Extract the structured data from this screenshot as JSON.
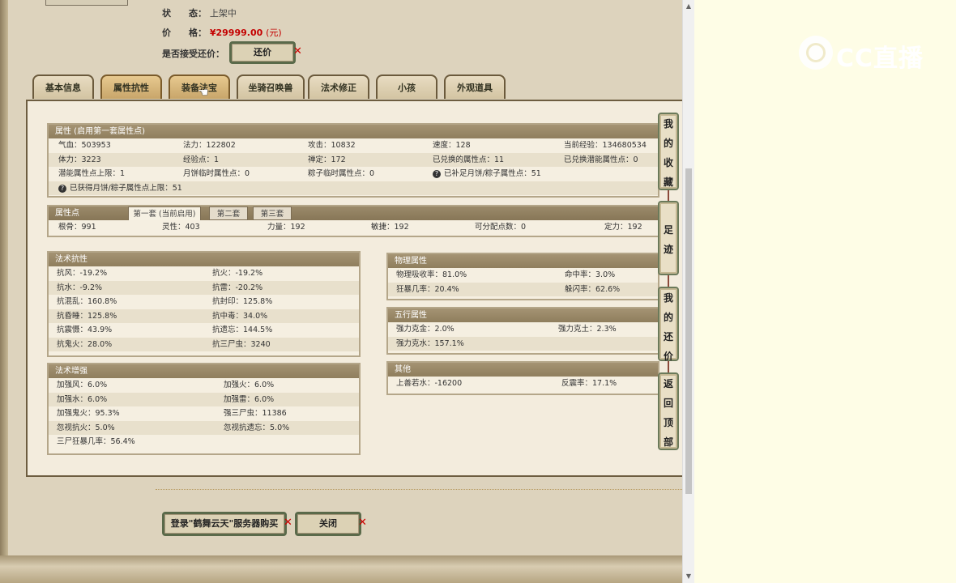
{
  "item_info": {
    "status_label": "状　　态：",
    "status_value": "上架中",
    "price_label": "价　　格：",
    "price_value": "¥29999.00",
    "price_unit": "(元)",
    "counter_offer_label": "是否接受还价：",
    "counter_offer_button": "还价"
  },
  "tabs": [
    "基本信息",
    "属性抗性",
    "装备法宝",
    "坐骑召唤兽",
    "法术修正",
    "小孩",
    "外观道具"
  ],
  "attributes": {
    "title": "属性 (启用第一套属性点)",
    "rows": [
      [
        "气血：503953",
        "法力：122802",
        "攻击：10832",
        "速度：128",
        "当前经验：134680534"
      ],
      [
        "体力：3223",
        "经验点：1",
        "禅定：172",
        "已兑换的属性点：11",
        "已兑换潜能属性点：0"
      ],
      [
        "潜能属性点上限：1",
        "月饼临时属性点：0",
        "粽子临时属性点：0",
        "已补足月饼/粽子属性点：51",
        ""
      ],
      [
        "已获得月饼/粽子属性点上限：51",
        "",
        "",
        "",
        ""
      ]
    ]
  },
  "attr_points": {
    "title": "属性点",
    "subtabs": [
      "第一套 (当前启用)",
      "第二套",
      "第三套"
    ],
    "values": [
      "根骨：991",
      "灵性：403",
      "力量：192",
      "敏捷：192",
      "可分配点数：0",
      "定力：192"
    ]
  },
  "spell_resist": {
    "title": "法术抗性",
    "rows": [
      [
        "抗风：-19.2%",
        "抗火：-19.2%"
      ],
      [
        "抗水：-9.2%",
        "抗雷：-20.2%"
      ],
      [
        "抗混乱：160.8%",
        "抗封印：125.8%"
      ],
      [
        "抗昏睡：125.8%",
        "抗中毒：34.0%"
      ],
      [
        "抗震慑：43.9%",
        "抗遗忘：144.5%"
      ],
      [
        "抗鬼火：28.0%",
        "抗三尸虫：3240"
      ]
    ]
  },
  "spell_enhance": {
    "title": "法术增强",
    "rows": [
      [
        "加强风：6.0%",
        "加强火：6.0%"
      ],
      [
        "加强水：6.0%",
        "加强雷：6.0%"
      ],
      [
        "加强鬼火：95.3%",
        "强三尸虫：11386"
      ],
      [
        "忽视抗火：5.0%",
        "忽视抗遗忘：5.0%"
      ],
      [
        "三尸狂暴几率：56.4%",
        ""
      ]
    ]
  },
  "physical": {
    "title": "物理属性",
    "rows": [
      [
        "物理吸收率：81.0%",
        "命中率：3.0%"
      ],
      [
        "狂暴几率：20.4%",
        "躲闪率：62.6%"
      ]
    ]
  },
  "five_elements": {
    "title": "五行属性",
    "rows": [
      [
        "强力克金：2.0%",
        "强力克土：2.3%"
      ],
      [
        "强力克水：157.1%",
        ""
      ]
    ]
  },
  "other": {
    "title": "其他",
    "rows": [
      [
        "上善若水：-16200",
        "反震率：17.1%"
      ]
    ]
  },
  "sidebar": {
    "favorites": [
      "我",
      "的",
      "收",
      "藏"
    ],
    "footprints": [
      "足",
      "迹"
    ],
    "my_offers": [
      "我",
      "的",
      "还",
      "价"
    ],
    "back_top": [
      "返",
      "回",
      "顶",
      "部"
    ]
  },
  "footer": {
    "login_button": "登录\"鹤舞云天\"服务器购买",
    "close_button": "关闭"
  },
  "watermark": "CC直播",
  "colors": {
    "price": "#c40000",
    "section_header": "#9a8969",
    "panel_bg": "#f3ecdd",
    "page_bg": "#fefde6"
  },
  "icons": [
    "question-icon",
    "cursor-hand-icon",
    "close-x-icon",
    "cc-logo-icon"
  ]
}
